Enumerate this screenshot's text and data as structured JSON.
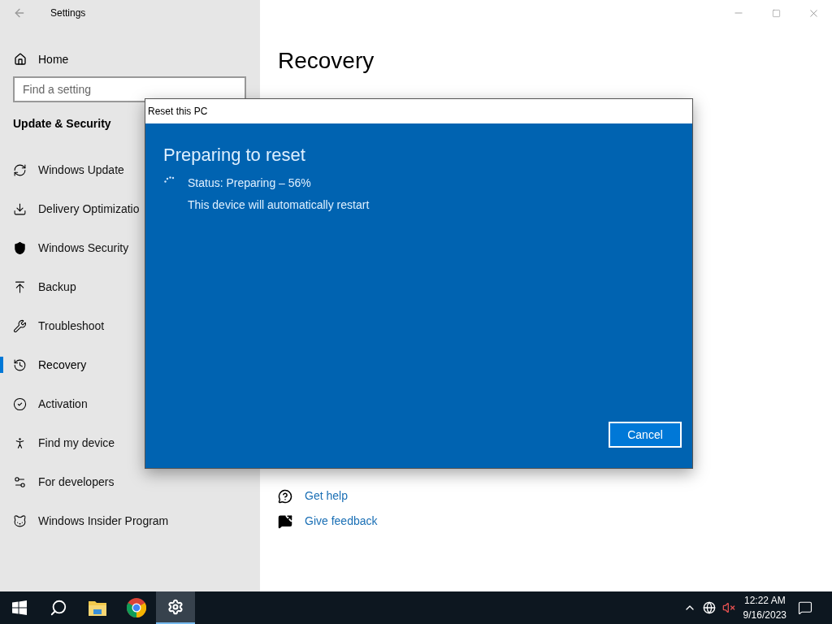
{
  "window": {
    "title": "Settings"
  },
  "sidebar": {
    "home": "Home",
    "search": {
      "placeholder": "Find a setting"
    },
    "section": "Update & Security",
    "items": [
      {
        "label": "Windows Update",
        "kind": "sync",
        "selected": false
      },
      {
        "label": "Delivery Optimizatio",
        "kind": "delivery",
        "selected": false
      },
      {
        "label": "Windows Security",
        "kind": "shield",
        "selected": false
      },
      {
        "label": "Backup",
        "kind": "backup",
        "selected": false
      },
      {
        "label": "Troubleshoot",
        "kind": "wrench",
        "selected": false
      },
      {
        "label": "Recovery",
        "kind": "recovery",
        "selected": true
      },
      {
        "label": "Activation",
        "kind": "check",
        "selected": false
      },
      {
        "label": "Find my device",
        "kind": "person",
        "selected": false
      },
      {
        "label": "For developers",
        "kind": "tools",
        "selected": false
      },
      {
        "label": "Windows Insider Program",
        "kind": "cat",
        "selected": false
      }
    ]
  },
  "page": {
    "title": "Recovery",
    "links": [
      {
        "label": "Get help",
        "kind": "help"
      },
      {
        "label": "Give feedback",
        "kind": "feedback"
      }
    ]
  },
  "dialog": {
    "title": "Reset this PC",
    "heading": "Preparing to reset",
    "status": "Status: Preparing – 56%",
    "note": "This device will automatically restart",
    "button": "Cancel"
  },
  "taskbar": {
    "apps": [
      {
        "kind": "start",
        "selected": false
      },
      {
        "kind": "search",
        "selected": false
      },
      {
        "kind": "folder",
        "selected": false
      },
      {
        "kind": "browser",
        "selected": false
      },
      {
        "kind": "gear",
        "selected": true
      }
    ],
    "clock": {
      "time": "12:22 AM",
      "date": "9/16/2023"
    }
  }
}
